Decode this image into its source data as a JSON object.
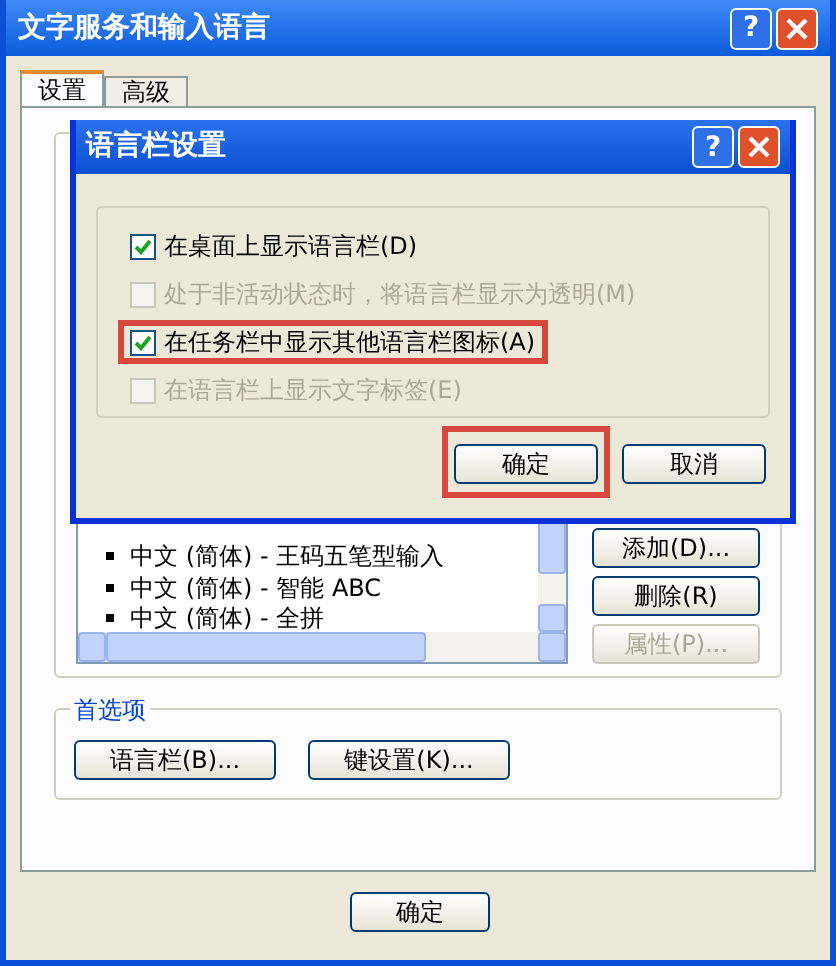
{
  "window": {
    "title": "文字服务和输入语言",
    "help": "?"
  },
  "tabs": [
    {
      "label": "设置",
      "selected": true
    },
    {
      "label": "高级",
      "selected": false
    }
  ],
  "services": {
    "items": [
      "中文 (简体) - 王码五笔型输入",
      "中文 (简体) - 智能 ABC",
      "中文 (简体) - 全拼"
    ],
    "buttons": [
      {
        "label": "添加(D)...",
        "disabled": false
      },
      {
        "label": "删除(R)",
        "disabled": false
      },
      {
        "label": "属性(P)...",
        "disabled": true
      }
    ]
  },
  "preferences": {
    "title": "首选项",
    "buttons": [
      "语言栏(B)...",
      "键设置(K)..."
    ]
  },
  "footer_buttons": [
    "确定"
  ],
  "dialog": {
    "title": "语言栏设置",
    "help": "?",
    "options": [
      {
        "label": "在桌面上显示语言栏(D)",
        "checked": true,
        "disabled": false,
        "highlighted": false
      },
      {
        "label": "处于非活动状态时，将语言栏显示为透明(M)",
        "checked": false,
        "disabled": true,
        "highlighted": false
      },
      {
        "label": "在任务栏中显示其他语言栏图标(A)",
        "checked": true,
        "disabled": false,
        "highlighted": true
      },
      {
        "label": "在语言栏上显示文字标签(E)",
        "checked": false,
        "disabled": true,
        "highlighted": false
      }
    ],
    "buttons": [
      {
        "label": "确定",
        "highlighted": true
      },
      {
        "label": "取消",
        "highlighted": false
      }
    ]
  }
}
